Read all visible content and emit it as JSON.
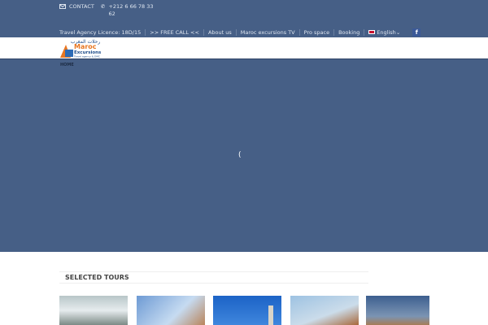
{
  "topbar": {
    "contact": "CONTACT",
    "phone": "+212 6 66 78 33 62",
    "links": [
      "Travel Agency Licence: 18D/15",
      ">> FREE CALL <<",
      "About us",
      "Maroc excursions TV",
      "Pro space",
      "Booking"
    ],
    "language": "English",
    "facebook": "f"
  },
  "logo": {
    "arabic": "رحلات المغرب",
    "line1": "Maroc",
    "line2": "Excursions",
    "tagline": "Travel agency & DMC"
  },
  "nav": {
    "home": "HOME"
  },
  "hero": {
    "loader": "("
  },
  "tours": {
    "title": "SELECTED TOURS"
  }
}
